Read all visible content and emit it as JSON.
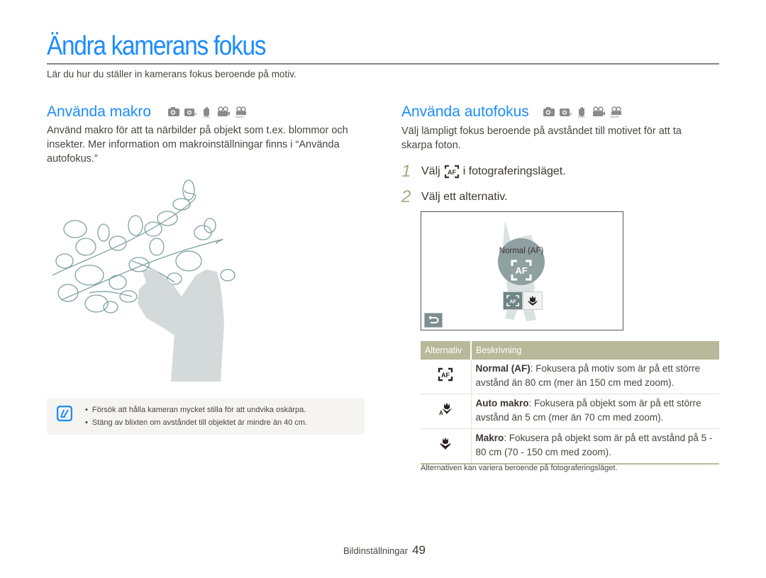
{
  "page": {
    "title": "Ändra kamerans fokus",
    "intro": "Lär du hur du ställer in kamerans fokus beroende på motiv."
  },
  "mode_icons": [
    "camera-auto-icon",
    "camera-program-icon",
    "dual-is-icon",
    "movie-icon",
    "smart-movie-icon"
  ],
  "macro_section": {
    "heading": "Använda makro",
    "paragraph": "Använd makro för att ta närbilder på objekt som t.ex. blommor och insekter. Mer information om makroinställningar finns i “Använda autofokus.”",
    "illustration": "magnolia-branch-with-photographer-silhouette",
    "notes": [
      "Försök att hålla kameran mycket stilla för att undvika oskärpa.",
      "Stäng av blixten om avståndet till objektet är mindre än 40 cm."
    ]
  },
  "autofocus_section": {
    "heading": "Använda autofokus",
    "paragraph": "Välj lämpligt fokus beroende på avståndet till motivet för att ta skarpa foton.",
    "steps": [
      {
        "num": "1",
        "before": "Välj",
        "icon": "af-icon",
        "after": "i fotograferingsläget."
      },
      {
        "num": "2",
        "before": "Välj ett alternativ.",
        "icon": null,
        "after": ""
      }
    ],
    "screen": {
      "label": "Normal (AF)",
      "options": [
        "af-icon",
        "macro-icon"
      ],
      "selected": "af-icon",
      "back": "back-icon"
    },
    "table": {
      "headers": [
        "Alternativ",
        "Beskrivning"
      ],
      "rows": [
        {
          "icon": "af-icon",
          "term": "Normal (AF)",
          "desc": ": Fokusera på motiv som är på ett större avstånd än 80 cm (mer än 150 cm med zoom)."
        },
        {
          "icon": "auto-macro-icon",
          "term": "Auto makro",
          "desc": ": Fokusera på objekt som är på ett större avstånd än 5 cm (mer än 70 cm med zoom)."
        },
        {
          "icon": "macro-icon",
          "term": "Makro",
          "desc": ": Fokusera på objekt som är på ett avstånd på 5 - 80 cm (70 - 150 cm med zoom)."
        }
      ]
    },
    "footnote": "Alternativen kan variera beroende på fotograferingsläget."
  },
  "footer": {
    "section": "Bildinställningar",
    "page_number": "49"
  },
  "colors": {
    "accent": "#1a8cff",
    "table_header": "#b8b89a",
    "step_number": "#a5ad84",
    "text": "#4a4443"
  }
}
